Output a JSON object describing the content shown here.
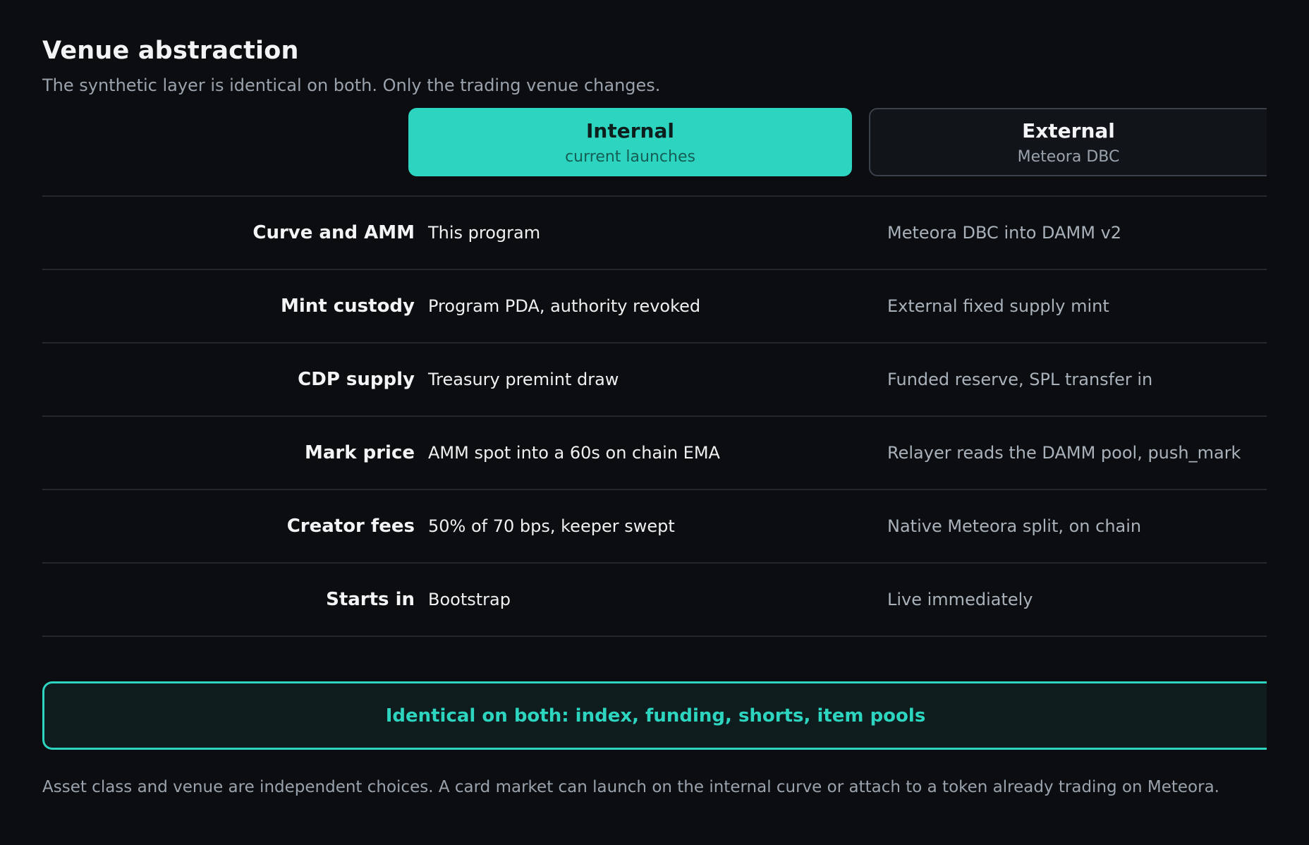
{
  "header": {
    "title": "Venue abstraction",
    "subtitle": "The synthetic layer is identical on both. Only the trading venue changes."
  },
  "columns": {
    "internal": {
      "title": "Internal",
      "subtitle": "current launches"
    },
    "external": {
      "title": "External",
      "subtitle": "Meteora DBC"
    }
  },
  "rows": [
    {
      "label": "Curve and AMM",
      "internal": "This program",
      "external": "Meteora DBC into DAMM v2"
    },
    {
      "label": "Mint custody",
      "internal": "Program PDA, authority revoked",
      "external": "External fixed supply mint"
    },
    {
      "label": "CDP supply",
      "internal": "Treasury premint draw",
      "external": "Funded reserve, SPL transfer in"
    },
    {
      "label": "Mark price",
      "internal": "AMM spot into a 60s on chain EMA",
      "external": "Relayer reads the DAMM pool, push_mark"
    },
    {
      "label": "Creator fees",
      "internal": "50% of 70 bps, keeper swept",
      "external": "Native Meteora split, on chain"
    },
    {
      "label": "Starts in",
      "internal": "Bootstrap",
      "external": "Live immediately"
    }
  ],
  "callout": {
    "text": "Identical on both: index, funding, shorts, item pools"
  },
  "footnote": "Asset class and venue are independent choices. A card market can launch on the internal curve or attach to a token already trading on Meteora.",
  "colors": {
    "accent": "#2dd4bf",
    "background": "#0b0d10",
    "divider": "#22272e",
    "muted_text": "#9aa3ad"
  }
}
